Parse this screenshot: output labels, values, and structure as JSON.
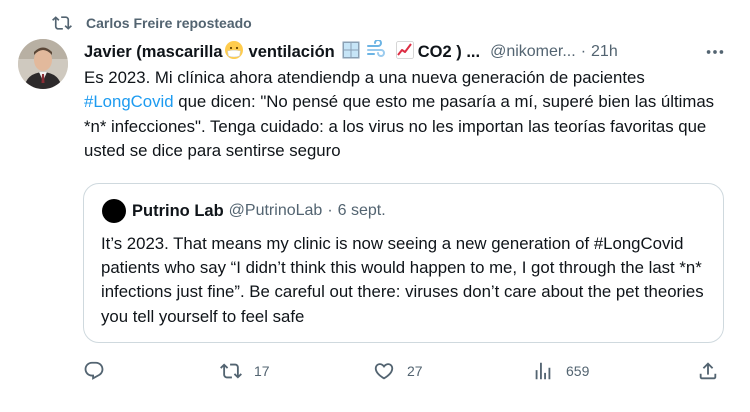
{
  "repost": {
    "text": "Carlos Freire reposteado"
  },
  "tweet": {
    "display_name": "Javier (mascarilla",
    "display_name_rest": "ventilación",
    "display_name_tail": "CO2 ) ...",
    "handle": "@nikomer...",
    "separator": "·",
    "time": "21h",
    "text_part1": "Es 2023. Mi clínica ahora atendiendp a una nueva generación de pacientes ",
    "hashtag": "#LongCovid",
    "text_part2": " que dicen: \"No pensé que esto me pasaría a mí, superé bien las últimas *n* infecciones\".  Tenga cuidado: a los virus no les importan las teorías favoritas que usted se dice para sentirse seguro"
  },
  "quote": {
    "name": "Putrino Lab",
    "handle": "@PutrinoLab",
    "separator": "·",
    "date": "6 sept.",
    "text": "It’s 2023. That means my clinic is now seeing a new generation of #LongCovid patients who say “I didn’t think this would happen to me, I got through the last *n* infections just fine”. Be careful out there: viruses don’t care about the pet theories you tell yourself to feel safe"
  },
  "actions": {
    "reply_count": "",
    "repost_count": "17",
    "like_count": "27",
    "views_count": "659"
  },
  "icons": {
    "repost": "repost-icon",
    "more": "more-icon",
    "reply": "reply-icon",
    "like": "heart-icon",
    "views": "views-icon",
    "share": "share-icon"
  },
  "colors": {
    "accent": "#1d9bf0",
    "secondary_text": "#536471",
    "border": "#cfd9de"
  }
}
